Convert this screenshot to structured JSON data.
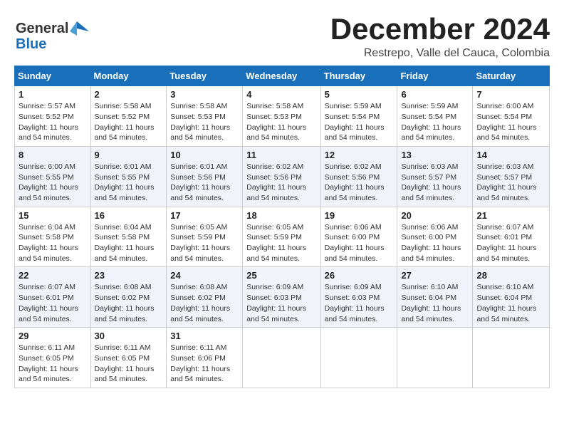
{
  "logo": {
    "line1": "General",
    "line2": "Blue"
  },
  "title": "December 2024",
  "location": "Restrepo, Valle del Cauca, Colombia",
  "days_of_week": [
    "Sunday",
    "Monday",
    "Tuesday",
    "Wednesday",
    "Thursday",
    "Friday",
    "Saturday"
  ],
  "weeks": [
    [
      {
        "day": "1",
        "info": "Sunrise: 5:57 AM\nSunset: 5:52 PM\nDaylight: 11 hours\nand 54 minutes."
      },
      {
        "day": "2",
        "info": "Sunrise: 5:58 AM\nSunset: 5:52 PM\nDaylight: 11 hours\nand 54 minutes."
      },
      {
        "day": "3",
        "info": "Sunrise: 5:58 AM\nSunset: 5:53 PM\nDaylight: 11 hours\nand 54 minutes."
      },
      {
        "day": "4",
        "info": "Sunrise: 5:58 AM\nSunset: 5:53 PM\nDaylight: 11 hours\nand 54 minutes."
      },
      {
        "day": "5",
        "info": "Sunrise: 5:59 AM\nSunset: 5:54 PM\nDaylight: 11 hours\nand 54 minutes."
      },
      {
        "day": "6",
        "info": "Sunrise: 5:59 AM\nSunset: 5:54 PM\nDaylight: 11 hours\nand 54 minutes."
      },
      {
        "day": "7",
        "info": "Sunrise: 6:00 AM\nSunset: 5:54 PM\nDaylight: 11 hours\nand 54 minutes."
      }
    ],
    [
      {
        "day": "8",
        "info": "Sunrise: 6:00 AM\nSunset: 5:55 PM\nDaylight: 11 hours\nand 54 minutes."
      },
      {
        "day": "9",
        "info": "Sunrise: 6:01 AM\nSunset: 5:55 PM\nDaylight: 11 hours\nand 54 minutes."
      },
      {
        "day": "10",
        "info": "Sunrise: 6:01 AM\nSunset: 5:56 PM\nDaylight: 11 hours\nand 54 minutes."
      },
      {
        "day": "11",
        "info": "Sunrise: 6:02 AM\nSunset: 5:56 PM\nDaylight: 11 hours\nand 54 minutes."
      },
      {
        "day": "12",
        "info": "Sunrise: 6:02 AM\nSunset: 5:56 PM\nDaylight: 11 hours\nand 54 minutes."
      },
      {
        "day": "13",
        "info": "Sunrise: 6:03 AM\nSunset: 5:57 PM\nDaylight: 11 hours\nand 54 minutes."
      },
      {
        "day": "14",
        "info": "Sunrise: 6:03 AM\nSunset: 5:57 PM\nDaylight: 11 hours\nand 54 minutes."
      }
    ],
    [
      {
        "day": "15",
        "info": "Sunrise: 6:04 AM\nSunset: 5:58 PM\nDaylight: 11 hours\nand 54 minutes."
      },
      {
        "day": "16",
        "info": "Sunrise: 6:04 AM\nSunset: 5:58 PM\nDaylight: 11 hours\nand 54 minutes."
      },
      {
        "day": "17",
        "info": "Sunrise: 6:05 AM\nSunset: 5:59 PM\nDaylight: 11 hours\nand 54 minutes."
      },
      {
        "day": "18",
        "info": "Sunrise: 6:05 AM\nSunset: 5:59 PM\nDaylight: 11 hours\nand 54 minutes."
      },
      {
        "day": "19",
        "info": "Sunrise: 6:06 AM\nSunset: 6:00 PM\nDaylight: 11 hours\nand 54 minutes."
      },
      {
        "day": "20",
        "info": "Sunrise: 6:06 AM\nSunset: 6:00 PM\nDaylight: 11 hours\nand 54 minutes."
      },
      {
        "day": "21",
        "info": "Sunrise: 6:07 AM\nSunset: 6:01 PM\nDaylight: 11 hours\nand 54 minutes."
      }
    ],
    [
      {
        "day": "22",
        "info": "Sunrise: 6:07 AM\nSunset: 6:01 PM\nDaylight: 11 hours\nand 54 minutes."
      },
      {
        "day": "23",
        "info": "Sunrise: 6:08 AM\nSunset: 6:02 PM\nDaylight: 11 hours\nand 54 minutes."
      },
      {
        "day": "24",
        "info": "Sunrise: 6:08 AM\nSunset: 6:02 PM\nDaylight: 11 hours\nand 54 minutes."
      },
      {
        "day": "25",
        "info": "Sunrise: 6:09 AM\nSunset: 6:03 PM\nDaylight: 11 hours\nand 54 minutes."
      },
      {
        "day": "26",
        "info": "Sunrise: 6:09 AM\nSunset: 6:03 PM\nDaylight: 11 hours\nand 54 minutes."
      },
      {
        "day": "27",
        "info": "Sunrise: 6:10 AM\nSunset: 6:04 PM\nDaylight: 11 hours\nand 54 minutes."
      },
      {
        "day": "28",
        "info": "Sunrise: 6:10 AM\nSunset: 6:04 PM\nDaylight: 11 hours\nand 54 minutes."
      }
    ],
    [
      {
        "day": "29",
        "info": "Sunrise: 6:11 AM\nSunset: 6:05 PM\nDaylight: 11 hours\nand 54 minutes."
      },
      {
        "day": "30",
        "info": "Sunrise: 6:11 AM\nSunset: 6:05 PM\nDaylight: 11 hours\nand 54 minutes."
      },
      {
        "day": "31",
        "info": "Sunrise: 6:11 AM\nSunset: 6:06 PM\nDaylight: 11 hours\nand 54 minutes."
      },
      {
        "day": "",
        "info": ""
      },
      {
        "day": "",
        "info": ""
      },
      {
        "day": "",
        "info": ""
      },
      {
        "day": "",
        "info": ""
      }
    ]
  ]
}
